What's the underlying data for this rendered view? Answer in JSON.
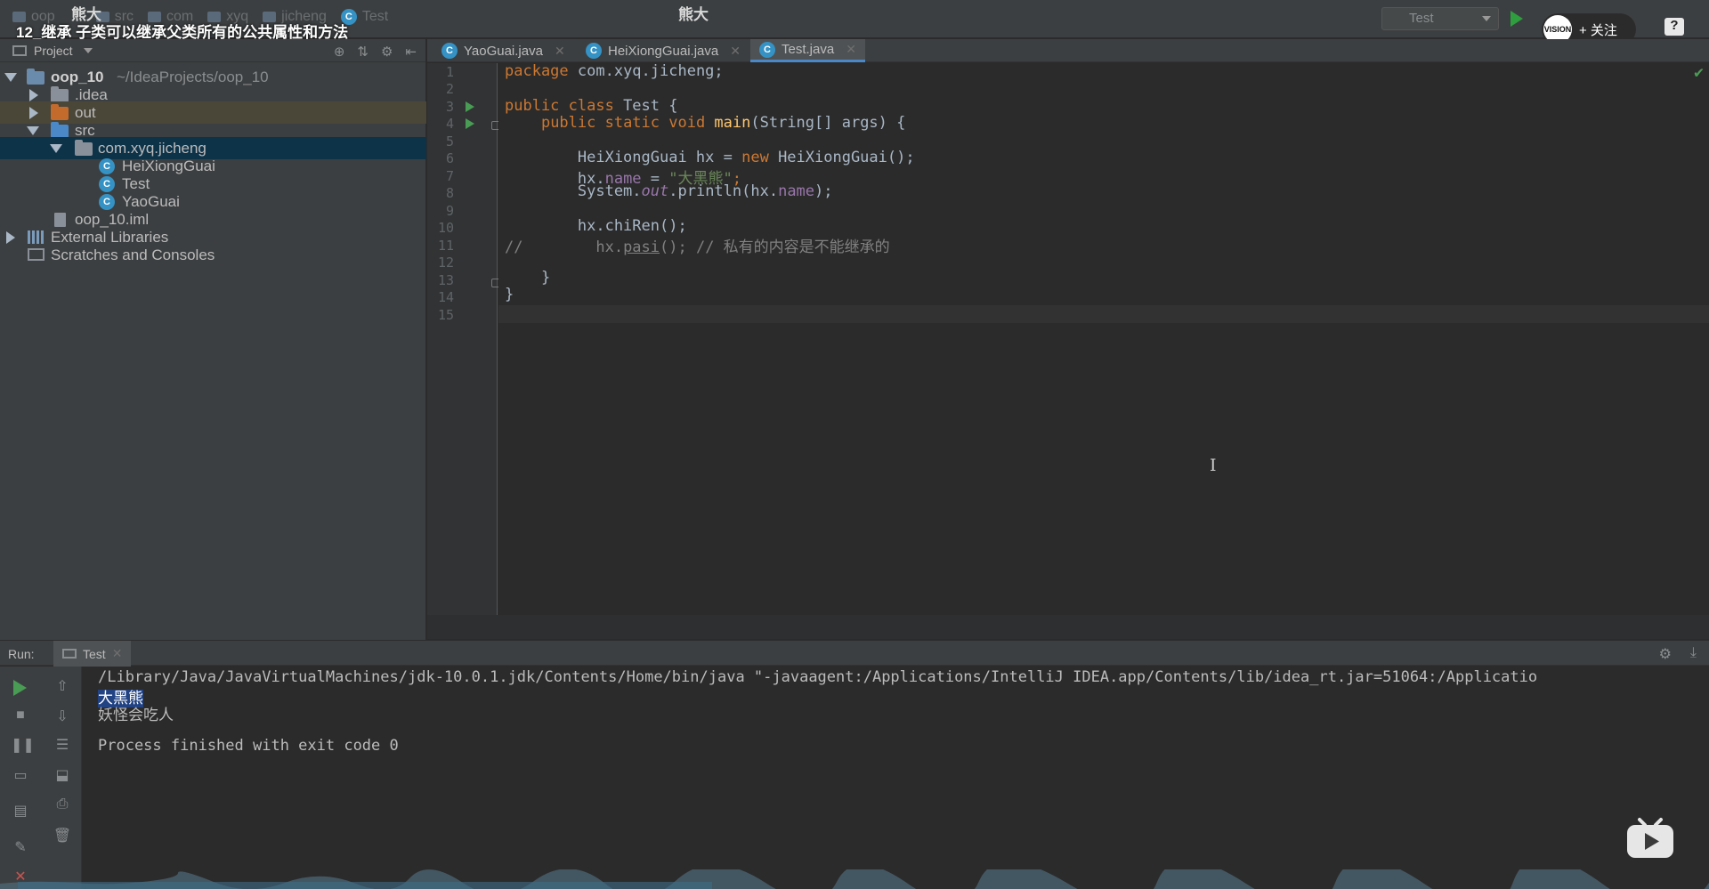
{
  "topbar": {
    "breadcrumbs": [
      "oop",
      "src",
      "com",
      "xyq",
      "jicheng"
    ],
    "current_file": "Test",
    "channel_name": "熊大",
    "center_title": "熊大",
    "video_title": "12_继承   子类可以继承父类所有的公共属性和方法",
    "run_config": "Test",
    "follow_label": "+ 关注",
    "avatar_text": "VISION",
    "help_label": "?"
  },
  "project": {
    "header_label": "Project",
    "tree": [
      {
        "label": "oop_10",
        "path": "~/IdeaProjects/oop_10"
      },
      {
        "label": ".idea"
      },
      {
        "label": "out"
      },
      {
        "label": "src"
      },
      {
        "label": "com.xyq.jicheng"
      },
      {
        "label": "HeiXiongGuai"
      },
      {
        "label": "Test"
      },
      {
        "label": "YaoGuai"
      },
      {
        "label": "oop_10.iml"
      },
      {
        "label": "External Libraries"
      },
      {
        "label": "Scratches and Consoles"
      }
    ]
  },
  "editor": {
    "tabs": [
      {
        "label": "YaoGuai.java"
      },
      {
        "label": "HeiXiongGuai.java"
      },
      {
        "label": "Test.java",
        "active": true
      }
    ],
    "line_numbers": [
      "1",
      "2",
      "3",
      "4",
      "5",
      "6",
      "7",
      "8",
      "9",
      "10",
      "11",
      "12",
      "13",
      "14",
      "15"
    ],
    "code": {
      "l1_kw": "package",
      "l1_rest": " com.xyq.jicheng;",
      "l3_kw": "public class",
      "l3_rest": " Test {",
      "l4_indent": "    ",
      "l4_kw": "public static void",
      "l4_fn": " main",
      "l4_rest": "(String[] args) {",
      "l6_a": "        HeiXiongGuai hx = ",
      "l6_kw": "new",
      "l6_b": " HeiXiongGuai();",
      "l7_a": "        hx.",
      "l7_fld": "name",
      "l7_b": " = ",
      "l7_str": "\"大黑熊\"",
      "l7_c": ";",
      "l8_a": "        System.",
      "l8_out": "out",
      "l8_b": ".println(hx.",
      "l8_fld": "name",
      "l8_c": ");",
      "l10": "        hx.chiRen();",
      "l11_prefix": "//        hx.",
      "l11_pasi": "pasi",
      "l11_rest": "(); // 私有的内容是不能继承的",
      "l13": "    }",
      "l14": "}"
    }
  },
  "run": {
    "label": "Run:",
    "tab_label": "Test",
    "console_lines": [
      "/Library/Java/JavaVirtualMachines/jdk-10.0.1.jdk/Contents/Home/bin/java \"-javaagent:/Applications/IntelliJ IDEA.app/Contents/lib/idea_rt.jar=51064:/Applicatio",
      "大黑熊",
      "妖怪会吃人",
      "Process finished with exit code 0"
    ]
  },
  "colors": {
    "keyword": "#cc7832",
    "string": "#6a8759",
    "field": "#9876aa",
    "method": "#ffc66d",
    "comment": "#808080",
    "selection": "#0d3349",
    "accent": "#4a88c7"
  }
}
